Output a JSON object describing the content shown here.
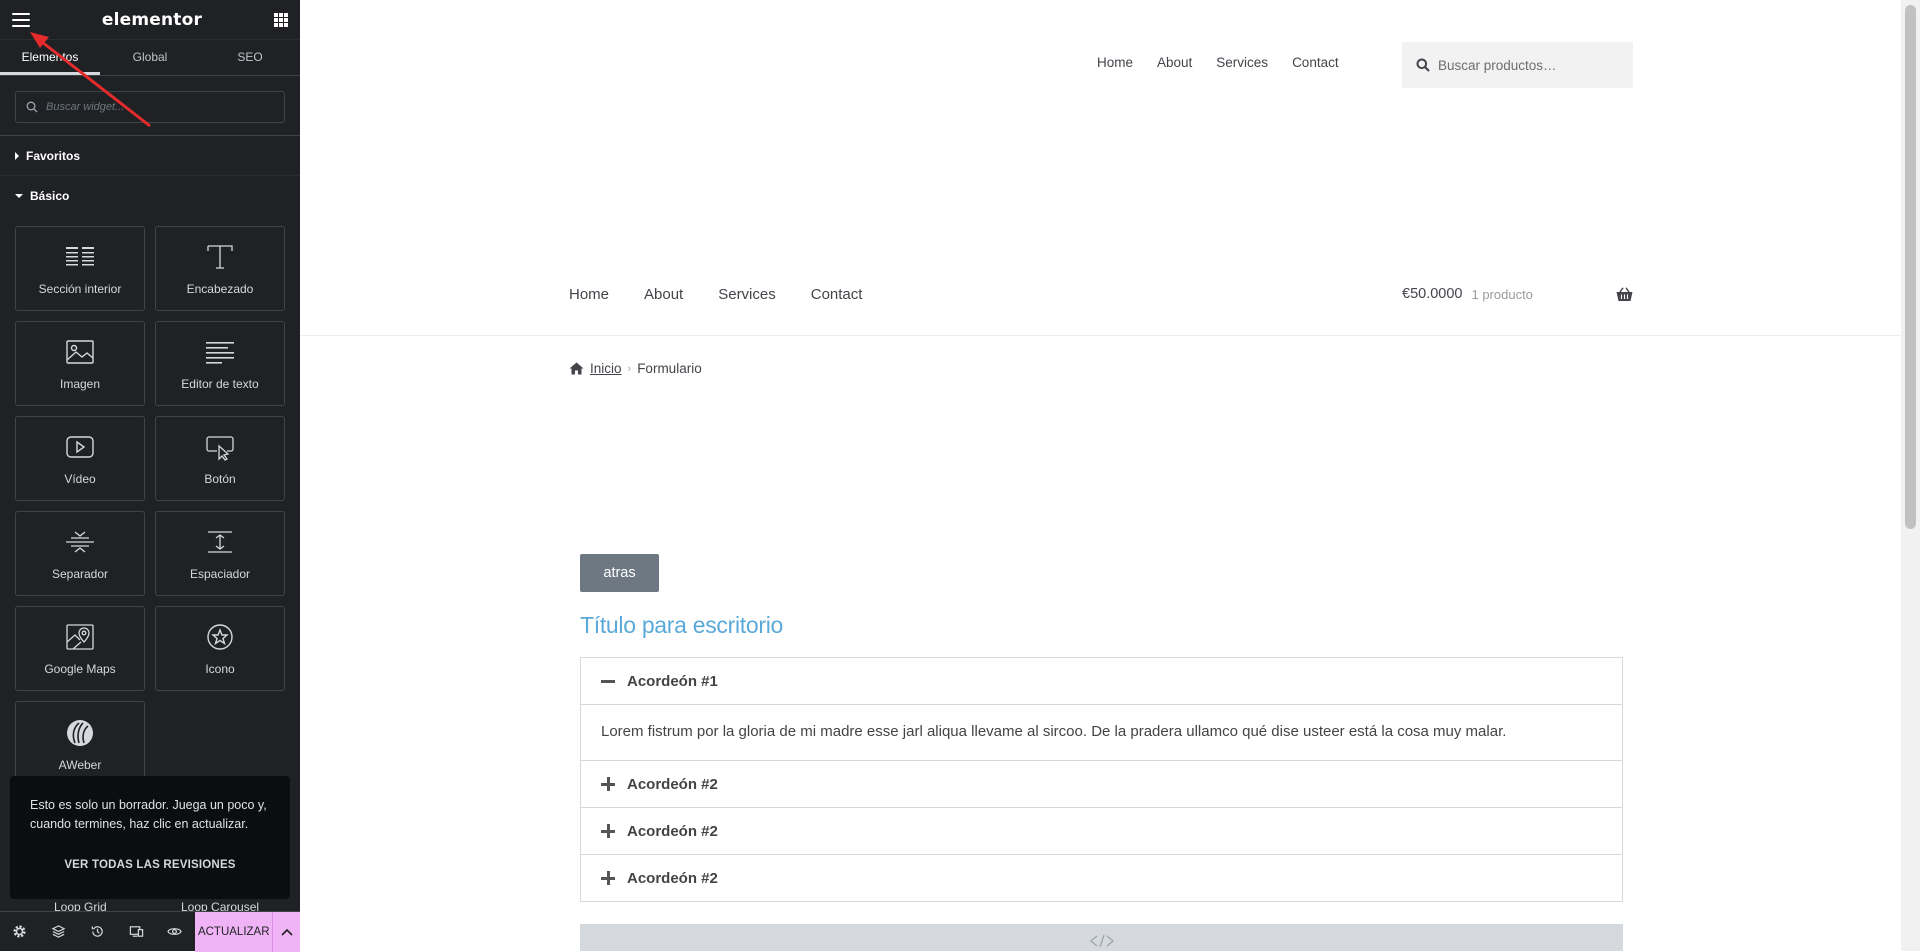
{
  "panel": {
    "logo": "elementor",
    "tabs": [
      "Elementos",
      "Global",
      "SEO"
    ],
    "search_placeholder": "Buscar widget...",
    "categories": {
      "favoritos": "Favoritos",
      "basico": "Básico"
    },
    "widgets": [
      {
        "label": "Sección interior",
        "icon": "inner-section-icon"
      },
      {
        "label": "Encabezado",
        "icon": "heading-icon"
      },
      {
        "label": "Imagen",
        "icon": "image-icon"
      },
      {
        "label": "Editor de texto",
        "icon": "text-editor-icon"
      },
      {
        "label": "Vídeo",
        "icon": "video-icon"
      },
      {
        "label": "Botón",
        "icon": "button-icon"
      },
      {
        "label": "Separador",
        "icon": "divider-icon"
      },
      {
        "label": "Espaciador",
        "icon": "spacer-icon"
      },
      {
        "label": "Google Maps",
        "icon": "google-maps-icon"
      },
      {
        "label": "Icono",
        "icon": "star-icon"
      },
      {
        "label": "AWeber",
        "icon": "aweber-icon"
      }
    ],
    "toast": {
      "message": "Esto es solo un borrador. Juega un poco y, cuando termines, haz clic en actualizar.",
      "link": "VER TODAS LAS REVISIONES"
    },
    "behind_toast_labels": [
      "Loop Grid",
      "Loop Carousel"
    ],
    "footer": {
      "update_label": "ACTUALIZAR",
      "update_color": "#f0b4f6"
    }
  },
  "preview": {
    "top_nav": [
      "Home",
      "About",
      "Services",
      "Contact"
    ],
    "product_search_placeholder": "Buscar productos…",
    "main_nav": [
      "Home",
      "About",
      "Services",
      "Contact"
    ],
    "cart": {
      "amount": "€50.0000",
      "items": "1 producto"
    },
    "breadcrumb": {
      "home": "Inicio",
      "current": "Formulario"
    },
    "back_button": "atras",
    "title": "Título para escritorio",
    "title_color": "#5ba9d9",
    "accordion": [
      {
        "title": "Acordeón #1",
        "open": true,
        "body": "Lorem fistrum por la gloria de mi madre esse jarl aliqua llevame al sircoo. De la pradera ullamco qué dise usteer está la cosa muy malar."
      },
      {
        "title": "Acordeón #2",
        "open": false
      },
      {
        "title": "Acordeón #2",
        "open": false
      },
      {
        "title": "Acordeón #2",
        "open": false
      }
    ]
  }
}
